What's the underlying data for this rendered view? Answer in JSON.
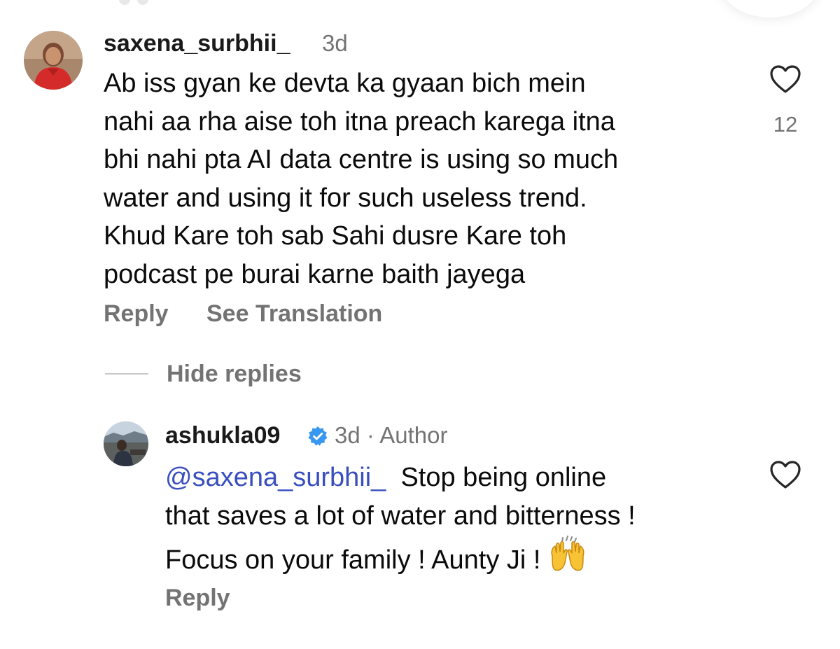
{
  "comment": {
    "username": "saxena_surbhii_",
    "time": "3d",
    "text": "Ab iss gyan ke devta ka gyaan bich mein\nnahi aa rha aise toh itna preach karega itna\nbhi nahi pta AI data centre is using so much\nwater and using it for such useless trend.\nKhud Kare toh sab Sahi dusre Kare toh\npodcast pe burai karne baith jayega",
    "like_count": "12",
    "reply_label": "Reply",
    "translate_label": "See Translation",
    "icons": {
      "like": "heart-outline-icon"
    }
  },
  "replies_toggle": {
    "label": "Hide replies"
  },
  "reply": {
    "username": "ashukla09",
    "verified": true,
    "time_author": "3d · Author",
    "mention": "@saxena_surbhii_",
    "text_line1": "Stop being online",
    "text_line2": "that saves a lot of water and bitterness !",
    "text_line3": "Focus on your family ! Aunty Ji !",
    "emoji": "🙌",
    "reply_label": "Reply",
    "icons": {
      "like": "heart-outline-icon",
      "verified": "verified-badge-icon"
    }
  },
  "colors": {
    "secondary_text": "#737373",
    "mention": "#3a4fbf",
    "verified_badge": "#3897f0"
  }
}
